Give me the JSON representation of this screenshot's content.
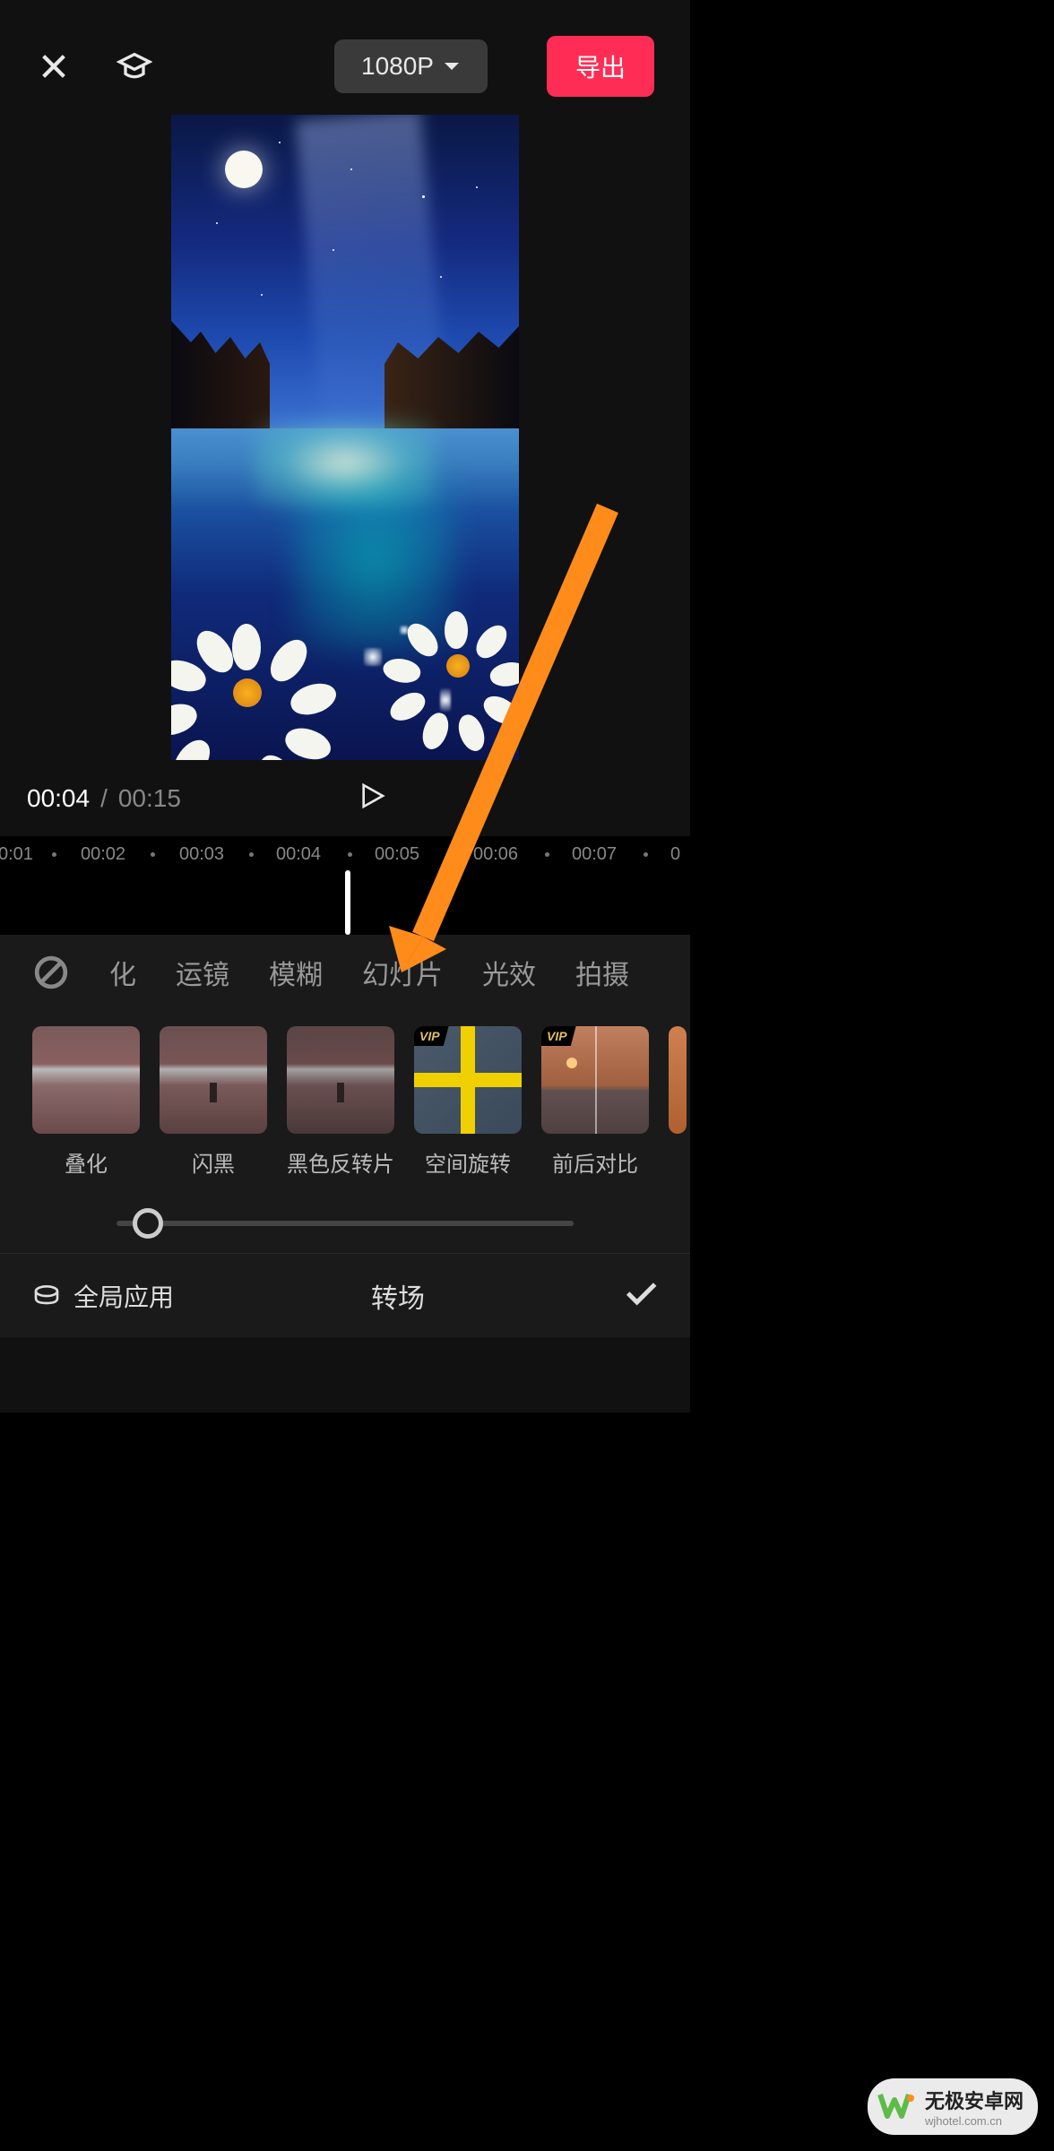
{
  "header": {
    "resolution": "1080P",
    "export": "导出"
  },
  "playback": {
    "current": "00:04",
    "separator": "/",
    "total": "00:15"
  },
  "timeline": {
    "ticks": [
      "0:01",
      "00:02",
      "00:03",
      "00:04",
      "00:05",
      "00:06",
      "00:07",
      "0"
    ]
  },
  "categories": {
    "items": [
      "化",
      "运镜",
      "模糊",
      "幻灯片",
      "光效",
      "拍摄"
    ],
    "active_index": 3
  },
  "effects": [
    {
      "label": "叠化",
      "vip": false
    },
    {
      "label": "闪黑",
      "vip": false
    },
    {
      "label": "黑色反转片",
      "vip": false
    },
    {
      "label": "空间旋转",
      "vip": true
    },
    {
      "label": "前后对比",
      "vip": true
    }
  ],
  "vip_label": "VIP",
  "bottom": {
    "global": "全局应用",
    "transition": "转场"
  },
  "watermark": {
    "title": "无极安卓网",
    "sub": "wjhotel.com.cn"
  }
}
